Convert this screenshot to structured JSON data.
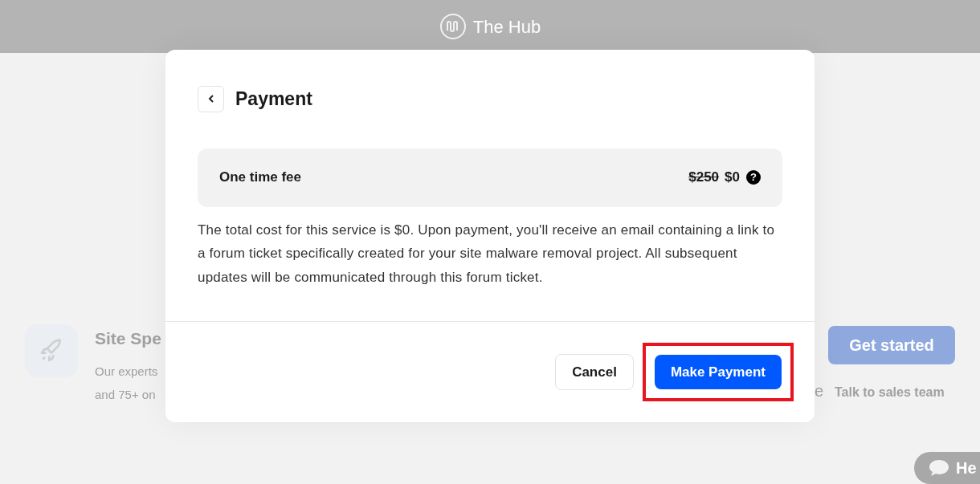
{
  "header": {
    "brand": "The Hub"
  },
  "background_card": {
    "title": "Site Spe",
    "description_lines": [
      "Our experts",
      "and 75+ on"
    ],
    "cut_letter": "e",
    "primary_button": "Get started",
    "link": "Talk to sales team"
  },
  "help_button": {
    "label": "He"
  },
  "dialog": {
    "title": "Payment",
    "fee": {
      "label": "One time fee",
      "old_price": "$250",
      "price": "$0",
      "help": "?"
    },
    "body": "The total cost for this service is $0. Upon payment, you'll receive an email containing a link to a forum ticket specifically created for your site malware removal project. All subsequent updates will be communicated through this forum ticket.",
    "buttons": [
      {
        "label": "Cancel",
        "kind": "secondary",
        "highlighted": false
      },
      {
        "label": "Make Payment",
        "kind": "primary",
        "highlighted": true
      }
    ]
  }
}
